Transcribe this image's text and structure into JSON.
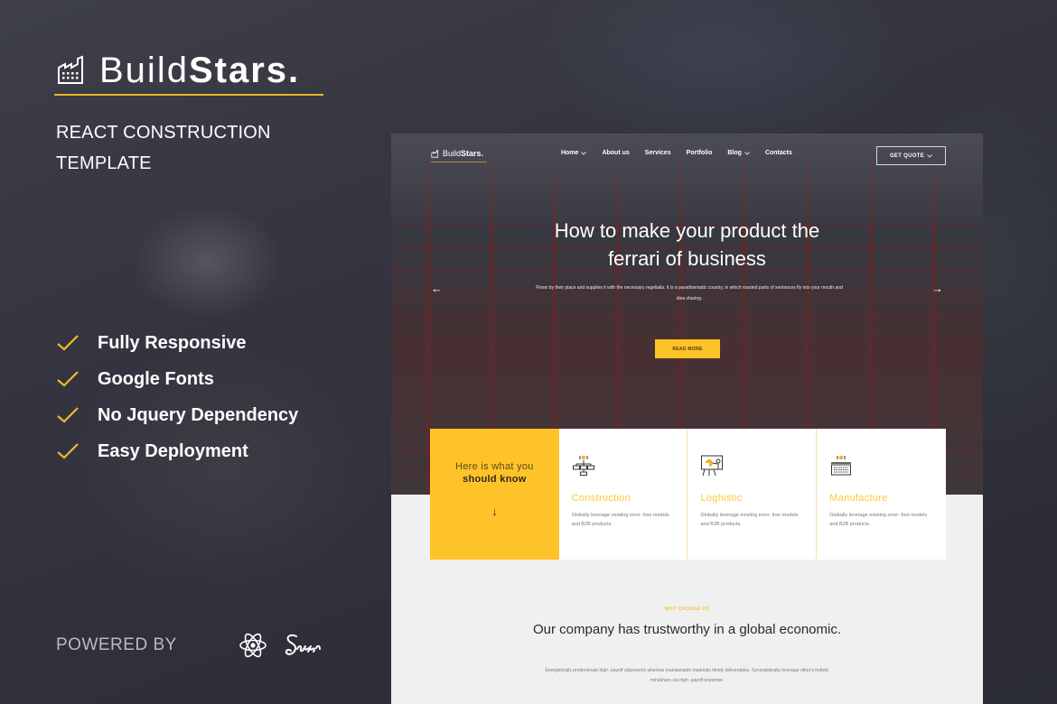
{
  "brand": {
    "name_light": "Build",
    "name_bold": "Stars.",
    "tagline": "REACT CONSTRUCTION TEMPLATE"
  },
  "features": [
    {
      "label": "Fully Responsive",
      "icon": "check-icon"
    },
    {
      "label": "Google Fonts",
      "icon": "check-icon"
    },
    {
      "label": "No Jquery Dependency",
      "icon": "check-icon"
    },
    {
      "label": "Easy Deployment",
      "icon": "check-icon"
    }
  ],
  "powered_by": {
    "label": "POWERED BY",
    "icons": [
      "react-icon",
      "sass-icon"
    ]
  },
  "colors": {
    "accent": "#fec328",
    "rule": "#e5b52b",
    "card_title": "#fbc93a"
  },
  "preview": {
    "nav": {
      "logo_light": "Build",
      "logo_bold": "Stars.",
      "links": [
        {
          "label": "Home",
          "has_caret": true
        },
        {
          "label": "About us",
          "has_caret": false
        },
        {
          "label": "Services",
          "has_caret": false
        },
        {
          "label": "Portfolio",
          "has_caret": false
        },
        {
          "label": "Blog",
          "has_caret": true
        },
        {
          "label": "Contacts",
          "has_caret": false
        }
      ],
      "cta": "GET QUOTE"
    },
    "hero": {
      "title_line1": "How to make your product the",
      "title_line2": "ferrari of business",
      "body": "Flows by their place and supplies it with the necessary regelialia. It is a paradisematic country, in which roasted parts of sentences fly into your mouth and idea sharing.",
      "button": "READ MORE",
      "prev": "←",
      "next": "→"
    },
    "intro_card": {
      "line1": "Here is what you",
      "line2": "should know",
      "arrow": "↓"
    },
    "service_cards": [
      {
        "title": "Construction",
        "desc": "Globally leverage existing error- free models and B2B products.",
        "icon": "flowchart-icon"
      },
      {
        "title": "Loghistic",
        "desc": "Globally leverage existing error- free models and B2B products.",
        "icon": "presentation-board-icon"
      },
      {
        "title": "Manufacture",
        "desc": "Globally leverage existing error- free models and B2B products.",
        "icon": "keyboard-icon"
      }
    ],
    "why": {
      "eyebrow": "WHY CHOOSE US",
      "title": "Our company has trustworthy in a global economic.",
      "body": "Energistically predominate high- payoff alignments whereas maintainable materials timely deliverables. Synergistically leverage other's holistic mindshare via high- payoff expertise."
    }
  }
}
